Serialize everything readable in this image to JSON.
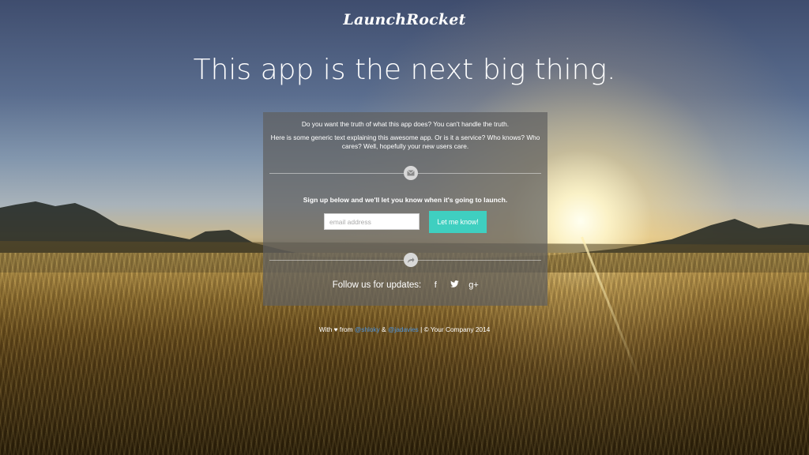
{
  "brand": {
    "logo": "LaunchRocket"
  },
  "hero": {
    "headline": "This app is the next big thing."
  },
  "intro": {
    "line1": "Do you want the truth of what this app does? You can't handle the truth.",
    "line2": "Here is some generic text explaining this awesome app. Or is it a service? Who knows? Who cares? Well, hopefully your new users care."
  },
  "signup": {
    "prompt": "Sign up below and we'll let you know when it's going to launch.",
    "email_placeholder": "email address",
    "email_value": "",
    "button_label": "Let me know!"
  },
  "social": {
    "label": "Follow us for updates:",
    "facebook": "f",
    "twitter": "🐦",
    "google_plus": "g+"
  },
  "footer": {
    "with": "With",
    "heart": "♥",
    "from": "from",
    "author1": "@shloky",
    "and": "&",
    "author2": "@jadavies",
    "copyright": "| © Your Company 2014"
  },
  "colors": {
    "accent": "#3fcfc0",
    "link": "#4a90d9",
    "panel_bg": "rgba(95,95,95,0.72)"
  },
  "icons": {
    "divider1": "envelope-icon",
    "divider2": "share-icon"
  }
}
